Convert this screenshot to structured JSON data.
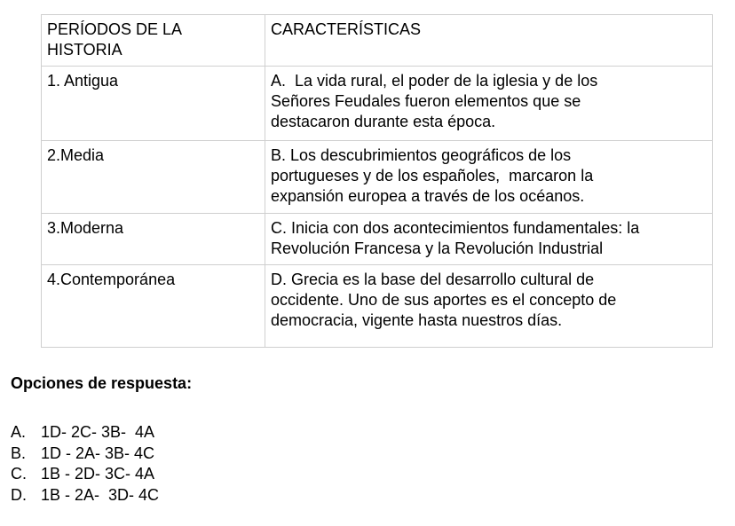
{
  "table": {
    "header": {
      "col1": [
        "PERÍODOS DE LA",
        "HISTORIA"
      ],
      "col2": [
        "CARACTERÍSTICAS"
      ]
    },
    "rows": [
      {
        "period": "1. Antigua",
        "desc": [
          "A.  La vida rural, el poder de la iglesia y de los",
          "Señores Feudales fueron elementos que se",
          "destacaron durante esta época."
        ]
      },
      {
        "period": "2.Media",
        "desc": [
          "B. Los descubrimientos geográficos de los",
          "portugueses y de los españoles,  marcaron la",
          "expansión europea a través de los océanos."
        ]
      },
      {
        "period": "3.Moderna",
        "desc": [
          "C. Inicia con dos acontecimientos fundamentales: la",
          "Revolución Francesa y la Revolución Industrial"
        ]
      },
      {
        "period": "4.Contemporánea",
        "desc": [
          "D. Grecia es la base del desarrollo cultural de",
          "occidente. Uno de sus aportes es el concepto de",
          "democracia, vigente hasta nuestros días."
        ]
      }
    ]
  },
  "options": {
    "heading": "Opciones de respuesta:",
    "items": [
      {
        "letter": "A.",
        "text": "1D- 2C- 3B-  4A"
      },
      {
        "letter": "B.",
        "text": "1D - 2A- 3B- 4C"
      },
      {
        "letter": "C.",
        "text": "1B - 2D- 3C- 4A"
      },
      {
        "letter": "D.",
        "text": "1B - 2A-  3D- 4C"
      }
    ]
  }
}
